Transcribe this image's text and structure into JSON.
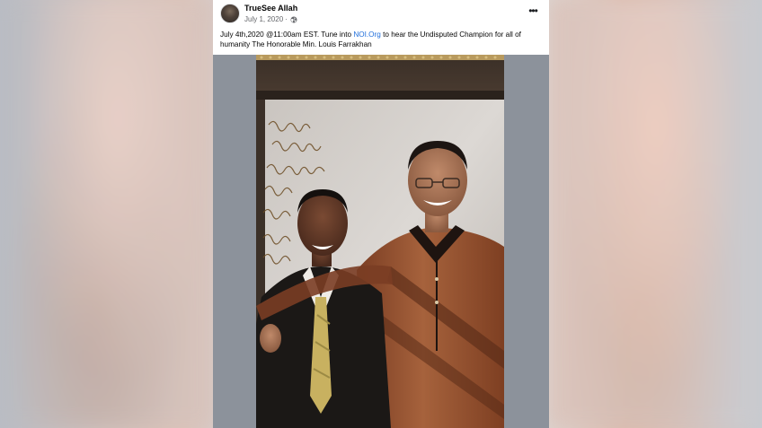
{
  "post": {
    "author": "TrueSee Allah",
    "date": "July 1, 2020",
    "separator": "·",
    "privacy_icon": "globe-icon",
    "more_icon": "more-options-icon",
    "more_label": "•••",
    "text_before_link": "July 4th,2020 @11:00am EST. Tune into ",
    "link_text": "NOI.Org",
    "text_after_link": " to hear the Undisputed Champion for all of humanity The Honorable Min. Louis Farrakhan",
    "photo_alt": "Autographed photo of two men posing together",
    "colors": {
      "link": "#216fdb",
      "secondary_text": "#65676b",
      "media_background": "#8c929b"
    }
  }
}
